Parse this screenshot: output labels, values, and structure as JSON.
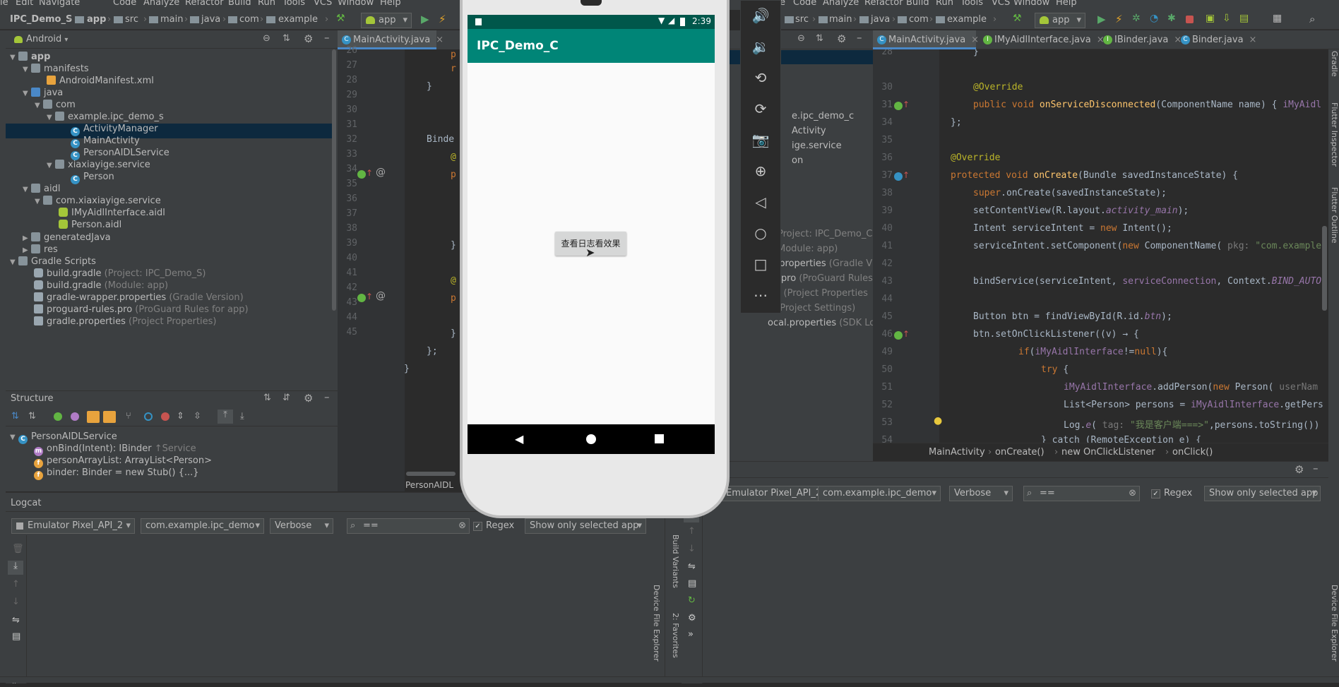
{
  "menu": {
    "left": [
      "le",
      "Edit",
      "Navigate",
      "Code",
      "Analyze",
      "Refactor",
      "Build",
      "Run",
      "Tools",
      "VCS",
      "Window",
      "Help"
    ],
    "right": [
      "e",
      "Code",
      "Analyze",
      "Refactor",
      "Build",
      "Run",
      "Tools",
      "VCS",
      "Window",
      "Help"
    ]
  },
  "breadcrumb_left": {
    "project": "IPC_Demo_S",
    "app": "app",
    "src": "src",
    "main": "main",
    "java": "java",
    "com": "com",
    "example": "example",
    "run_config": "app"
  },
  "breadcrumb_right": {
    "src": "src",
    "main": "main",
    "java": "java",
    "com": "com",
    "example": "example",
    "run_config": "app"
  },
  "project_pane": {
    "view_mode": "Android",
    "tree": [
      {
        "label": "app",
        "level": 0,
        "bold": true
      },
      {
        "label": "manifests",
        "level": 1
      },
      {
        "label": "AndroidManifest.xml",
        "level": 2
      },
      {
        "label": "java",
        "level": 1
      },
      {
        "label": "com",
        "level": 2
      },
      {
        "label": "example.ipc_demo_s",
        "level": 3,
        "selected": true
      },
      {
        "label": "ActivityManager",
        "level": 4
      },
      {
        "label": "MainActivity",
        "level": 4
      },
      {
        "label": "PersonAIDLService",
        "level": 4
      },
      {
        "label": "xiaxiayige.service",
        "level": 3
      },
      {
        "label": "Person",
        "level": 4
      },
      {
        "label": "aidl",
        "level": 1
      },
      {
        "label": "com.xiaxiayige.service",
        "level": 2
      },
      {
        "label": "IMyAidlInterface.aidl",
        "level": 3
      },
      {
        "label": "Person.aidl",
        "level": 3
      },
      {
        "label": "generatedJava",
        "level": 1
      },
      {
        "label": "res",
        "level": 1
      },
      {
        "label": "Gradle Scripts",
        "level": 0
      },
      {
        "label": "build.gradle",
        "hint": "(Project: IPC_Demo_S)",
        "level": 1
      },
      {
        "label": "build.gradle",
        "hint": "(Module: app)",
        "level": 1
      },
      {
        "label": "gradle-wrapper.properties",
        "hint": "(Gradle Version)",
        "level": 1
      },
      {
        "label": "proguard-rules.pro",
        "hint": "(ProGuard Rules for app)",
        "level": 1
      },
      {
        "label": "gradle.properties",
        "hint": "(Project Properties)",
        "level": 1
      }
    ]
  },
  "structure_pane": {
    "title": "Structure",
    "items": [
      {
        "label": "PersonAIDLService"
      },
      {
        "label": "onBind(Intent): IBinder",
        "hint": "↑Service"
      },
      {
        "label": "personArrayList: ArrayList<Person>"
      },
      {
        "label": "binder: Binder = new Stub() {...}"
      }
    ]
  },
  "left_editor": {
    "tab": "MainActivity.java",
    "line_numbers": [
      "26",
      "27",
      "28",
      "29",
      "30",
      "31",
      "32",
      "33",
      "34",
      "35",
      "36",
      "37",
      "38",
      "39",
      "40",
      "41",
      "42",
      "43",
      "44",
      "45"
    ],
    "line_26": "p",
    "line_27": "r",
    "line_28": "}",
    "line_31": "Binde",
    "line_32": "@",
    "line_33": "p",
    "line_37": "}",
    "line_39": "@",
    "line_40": "p",
    "line_42": "}",
    "line_43": "};",
    "line_44": "}",
    "footer": "PersonAIDL"
  },
  "logcat_left": {
    "title": "Logcat",
    "device": "Emulator Pixel_API_2",
    "package": "com.example.ipc_demo",
    "level": "Verbose",
    "search": "==",
    "regex_label": "Regex",
    "filter": "Show only selected app"
  },
  "emulator": {
    "time": "2:39",
    "app_title": "IPC_Demo_C",
    "button": "查看日志看效果"
  },
  "right_project_fragments": [
    {
      "text": "e.ipc_demo_c"
    },
    {
      "text": "Activity"
    },
    {
      "text": "ige.service"
    },
    {
      "text": "on"
    },
    {
      "text": "Project: IPC_Demo_C)",
      "grey": true
    },
    {
      "text": "Module: app)",
      "grey": true
    },
    {
      "text": "er.properties",
      "hint": "(Gradle V"
    },
    {
      "text": "es.pro",
      "hint": "(ProGuard Rules"
    },
    {
      "text": "ies",
      "hint": "(Project Properties"
    },
    {
      "text": "e",
      "hint": "(Project Settings)"
    },
    {
      "text": "ocal.properties",
      "hint": "(SDK Location)"
    }
  ],
  "right_editor": {
    "tabs": [
      "MainActivity.java",
      "IMyAidlInterface.java",
      "IBinder.java",
      "Binder.java"
    ],
    "line_numbers": [
      "28",
      "30",
      "31",
      "34",
      "35",
      "36",
      "37",
      "38",
      "39",
      "40",
      "41",
      "42",
      "43",
      "44",
      "45",
      "46",
      "49",
      "50",
      "51",
      "52",
      "53",
      "54"
    ],
    "code": {
      "l28": "}",
      "l30": "@Override",
      "l31a": "public void ",
      "l31b": "onServiceDisconnected",
      "l31c": "(ComponentName name) { ",
      "l31d": "iMyAidl",
      "l34": "};",
      "l36": "@Override",
      "l37a": "protected void ",
      "l37b": "onCreate",
      "l37c": "(Bundle savedInstanceState) {",
      "l38a": "super",
      "l38b": ".onCreate(savedInstanceState);",
      "l39a": "setContentView(R.layout.",
      "l39b": "activity_main",
      "l39c": ");",
      "l40a": "Intent serviceIntent = ",
      "l40b": "new ",
      "l40c": "Intent();",
      "l41a": "serviceIntent.setComponent(",
      "l41b": "new ",
      "l41c": "ComponentName( ",
      "l41d": "pkg: ",
      "l41e": "\"com.example",
      "l43a": "bindService(serviceIntent, ",
      "l43b": "serviceConnection",
      "l43c": ", Context.",
      "l43d": "BIND_AUTO",
      "l45a": "Button btn = findViewById(R.id.",
      "l45b": "btn",
      "l45c": ");",
      "l46": "btn.setOnClickListener((v) → {",
      "l49a": "if",
      "l49b": "(",
      "l49c": "iMyAidlInterface",
      "l49d": "!=",
      "l49e": "null",
      "l49f": "){",
      "l50a": "try ",
      "l50b": "{",
      "l51a": "iMyAidlInterface",
      "l51b": ".addPerson(",
      "l51c": "new ",
      "l51d": "Person( ",
      "l51e": "userNam",
      "l52a": "List<Person> persons = ",
      "l52b": "iMyAidlInterface",
      "l52c": ".getPers",
      "l53a": "Log.",
      "l53b": "e",
      "l53c": "( ",
      "l53d": "tag: ",
      "l53e": "\"我是客户端===>\"",
      "l53f": ",persons.toString())",
      "l54": "} catch (RemoteException e) {"
    },
    "breadcrumb": [
      "MainActivity",
      "onCreate()",
      "new OnClickListener",
      "onClick()"
    ]
  },
  "logcat_right": {
    "device": "Emulator Pixel_API_2",
    "package": "com.example.ipc_demo",
    "level": "Verbose",
    "search": "==",
    "regex_label": "Regex",
    "filter": "Show only selected app"
  },
  "side_labels": {
    "device_file_explorer": "Device File Explorer",
    "build_variants": "Build Variants",
    "favorites": "2: Favorites",
    "flutter_inspector": "Flutter Inspector",
    "flutter_outline": "Flutter Outline",
    "gradle": "Gradle"
  },
  "colors": {
    "accent": "#4a88c7",
    "app_bar": "#008577",
    "status_bar": "#00574b",
    "selection": "#0d293e"
  }
}
